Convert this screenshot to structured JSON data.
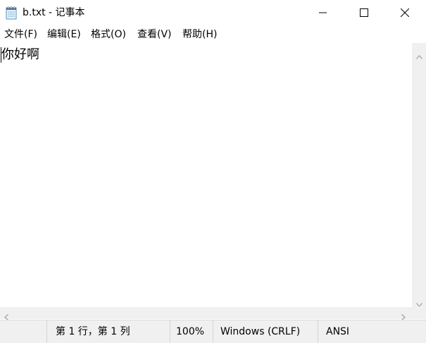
{
  "window": {
    "title": "b.txt - 记事本"
  },
  "icons": {
    "app": "notepad-icon",
    "minimize": "minimize-icon",
    "maximize": "maximize-icon",
    "close": "close-icon",
    "vscroll_up": "chevron-up-icon",
    "vscroll_down": "chevron-down-icon",
    "hscroll_left": "chevron-left-icon",
    "hscroll_right": "chevron-right-icon"
  },
  "menu": {
    "items": [
      {
        "label": "文件(F)"
      },
      {
        "label": "编辑(E)"
      },
      {
        "label": "格式(O)"
      },
      {
        "label": "查看(V)"
      },
      {
        "label": "帮助(H)"
      }
    ]
  },
  "editor": {
    "text": "你好啊"
  },
  "status": {
    "position": "第 1 行，第 1 列",
    "zoom": "100%",
    "line_ending": "Windows (CRLF)",
    "encoding": "ANSI"
  },
  "colors": {
    "chrome_gray": "#f0f0f0",
    "divider": "#d4d4d4",
    "text": "#000000",
    "scroll_arrow": "#a0a0a0"
  }
}
